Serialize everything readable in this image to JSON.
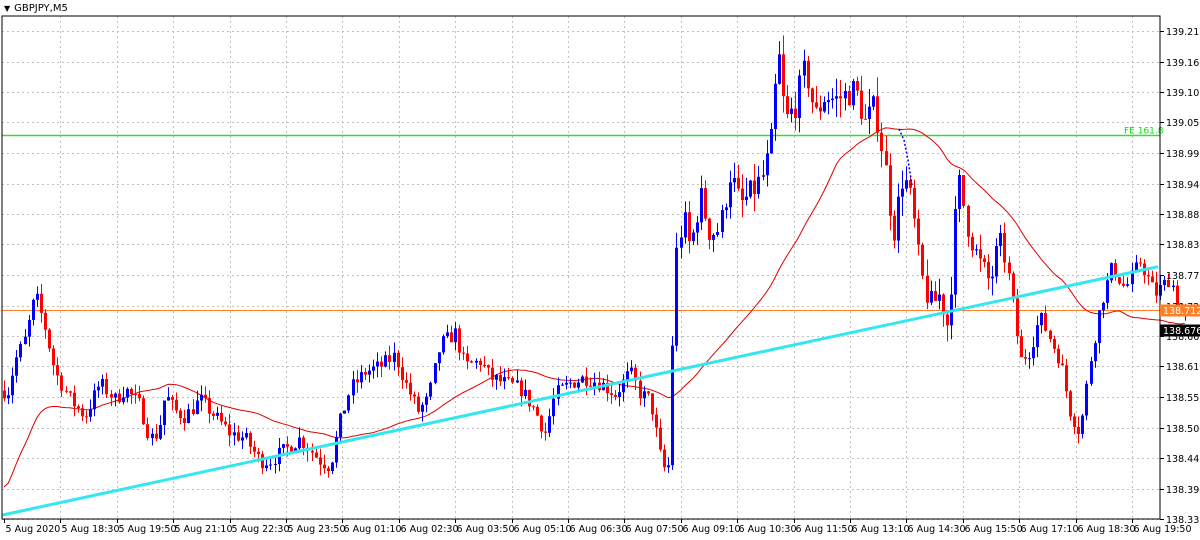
{
  "symbol": {
    "label": "GBPJPY,M5",
    "collapse_icon": "triangle-down-icon"
  },
  "colors": {
    "background": "#ffffff",
    "grid": "#c0c0c0",
    "bull": "#0000ff",
    "bear": "#ff0000",
    "moving_average": "#e00000",
    "trendline": "#33e6f0",
    "fib_line": "#33dd33",
    "horizontal_line": "#ff7f27",
    "price_tag_orange": "#ff7f27",
    "price_tag_black": "#000000"
  },
  "chart_data": {
    "type": "candlestick",
    "symbol": "GBPJPY",
    "timeframe": "M5",
    "y_ticks": [
      "139.215",
      "139.160",
      "139.105",
      "139.050",
      "138.995",
      "138.940",
      "138.885",
      "138.830",
      "138.775",
      "138.720",
      "138.665",
      "138.610",
      "138.555",
      "138.500",
      "138.445",
      "138.390",
      "138.335"
    ],
    "x_ticks": [
      "5 Aug 2020",
      "5 Aug 18:30",
      "5 Aug 19:50",
      "5 Aug 21:10",
      "5 Aug 22:30",
      "5 Aug 23:50",
      "6 Aug 01:10",
      "6 Aug 02:30",
      "6 Aug 03:50",
      "6 Aug 05:10",
      "6 Aug 06:30",
      "6 Aug 07:50",
      "6 Aug 09:10",
      "6 Aug 10:30",
      "6 Aug 11:50",
      "6 Aug 13:10",
      "6 Aug 14:30",
      "6 Aug 15:50",
      "6 Aug 17:10",
      "6 Aug 18:30",
      "6 Aug 19:50"
    ],
    "ylim": [
      138.335,
      139.215
    ],
    "horizontal_lines": [
      {
        "label": "FE 161.8",
        "price": 139.027,
        "color": "#33dd33"
      },
      {
        "label": "138.712",
        "price": 138.712,
        "color": "#ff7f27"
      }
    ],
    "current_price": "138.676",
    "price_path": [
      [
        0,
        138.6
      ],
      [
        6,
        138.55
      ],
      [
        15,
        138.62
      ],
      [
        25,
        138.66
      ],
      [
        35,
        138.74
      ],
      [
        45,
        138.68
      ],
      [
        55,
        138.6
      ],
      [
        70,
        138.55
      ],
      [
        85,
        138.52
      ],
      [
        100,
        138.58
      ],
      [
        115,
        138.55
      ],
      [
        125,
        138.57
      ],
      [
        140,
        138.54
      ],
      [
        150,
        138.48
      ],
      [
        158,
        138.49
      ],
      [
        165,
        138.56
      ],
      [
        175,
        138.53
      ],
      [
        185,
        138.52
      ],
      [
        200,
        138.55
      ],
      [
        215,
        138.52
      ],
      [
        230,
        138.49
      ],
      [
        245,
        138.48
      ],
      [
        260,
        138.44
      ],
      [
        270,
        138.44
      ],
      [
        285,
        138.46
      ],
      [
        300,
        138.48
      ],
      [
        310,
        138.46
      ],
      [
        320,
        138.44
      ],
      [
        330,
        138.43
      ],
      [
        340,
        138.51
      ],
      [
        350,
        138.57
      ],
      [
        365,
        138.6
      ],
      [
        380,
        138.61
      ],
      [
        395,
        138.63
      ],
      [
        405,
        138.58
      ],
      [
        418,
        138.53
      ],
      [
        428,
        138.55
      ],
      [
        440,
        138.65
      ],
      [
        455,
        138.67
      ],
      [
        465,
        138.61
      ],
      [
        480,
        138.62
      ],
      [
        490,
        138.59
      ],
      [
        505,
        138.58
      ],
      [
        520,
        138.57
      ],
      [
        535,
        138.53
      ],
      [
        545,
        138.49
      ],
      [
        555,
        138.56
      ],
      [
        570,
        138.58
      ],
      [
        585,
        138.59
      ],
      [
        600,
        138.58
      ],
      [
        615,
        138.56
      ],
      [
        630,
        138.6
      ],
      [
        640,
        138.56
      ],
      [
        650,
        138.55
      ],
      [
        662,
        138.43
      ],
      [
        668,
        138.42
      ],
      [
        675,
        138.8
      ],
      [
        683,
        138.88
      ],
      [
        690,
        138.82
      ],
      [
        700,
        138.92
      ],
      [
        710,
        138.85
      ],
      [
        720,
        138.86
      ],
      [
        730,
        138.96
      ],
      [
        740,
        138.9
      ],
      [
        750,
        138.92
      ],
      [
        762,
        138.95
      ],
      [
        770,
        139.0
      ],
      [
        778,
        139.18
      ],
      [
        785,
        139.05
      ],
      [
        795,
        139.08
      ],
      [
        805,
        139.15
      ],
      [
        815,
        139.06
      ],
      [
        825,
        139.1
      ],
      [
        835,
        139.09
      ],
      [
        845,
        139.1
      ],
      [
        855,
        139.11
      ],
      [
        865,
        139.05
      ],
      [
        875,
        139.08
      ],
      [
        885,
        138.97
      ],
      [
        893,
        138.85
      ],
      [
        903,
        138.96
      ],
      [
        912,
        138.9
      ],
      [
        920,
        138.78
      ],
      [
        930,
        138.72
      ],
      [
        940,
        138.74
      ],
      [
        948,
        138.68
      ],
      [
        958,
        138.95
      ],
      [
        968,
        138.86
      ],
      [
        978,
        138.8
      ],
      [
        990,
        138.76
      ],
      [
        1000,
        138.84
      ],
      [
        1010,
        138.76
      ],
      [
        1020,
        138.62
      ],
      [
        1030,
        138.64
      ],
      [
        1040,
        138.7
      ],
      [
        1050,
        138.66
      ],
      [
        1060,
        138.62
      ],
      [
        1070,
        138.53
      ],
      [
        1080,
        138.49
      ],
      [
        1090,
        138.62
      ],
      [
        1100,
        138.72
      ],
      [
        1112,
        138.79
      ],
      [
        1125,
        138.75
      ],
      [
        1140,
        138.8
      ],
      [
        1155,
        138.74
      ],
      [
        1170,
        138.77
      ],
      [
        1182,
        138.7
      ],
      [
        1188,
        138.71
      ]
    ]
  }
}
